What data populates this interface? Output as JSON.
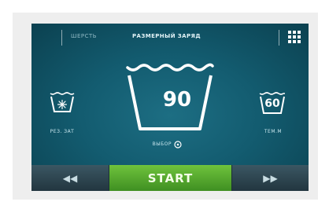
{
  "header": {
    "tab_label": "ШЕРСТЬ",
    "program_label": "РАЗМЕРНЫЙ ЗАРЯД"
  },
  "left_option": {
    "icon": "snowflake-icon",
    "label": "РЕЗ. ЗАТ"
  },
  "main_temperature": {
    "value": "90",
    "label": "ВЫБОР"
  },
  "right_option": {
    "value": "60",
    "label": "ТЕМ.М"
  },
  "controls": {
    "rewind_label": "◀◀",
    "start_label": "START",
    "forward_label": "▶▶"
  },
  "colors": {
    "screen_bg": "#135c70",
    "start_green": "#5aad30",
    "nav_gray": "#2f4650"
  }
}
